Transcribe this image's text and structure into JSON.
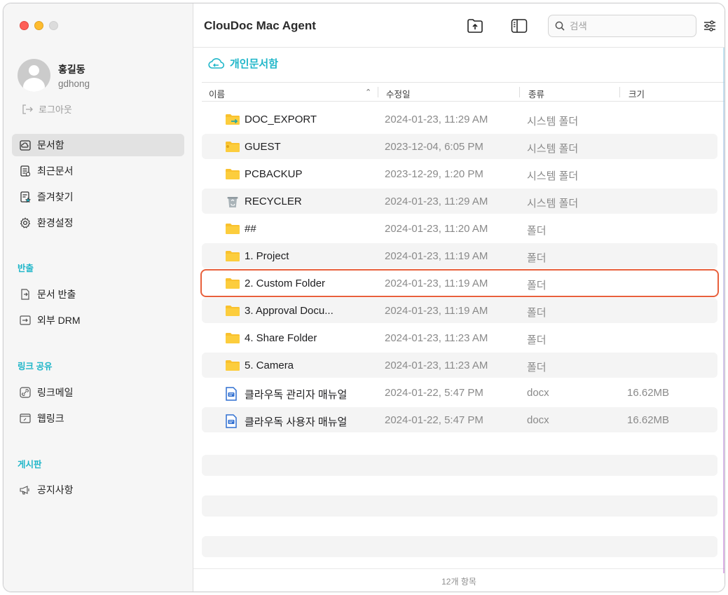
{
  "app": {
    "title": "ClouDoc Mac Agent"
  },
  "user": {
    "name": "홍길동",
    "id": "gdhong",
    "logout_label": "로그아웃"
  },
  "sidebar": {
    "items": [
      {
        "label": "문서함",
        "icon": "docbox-icon"
      },
      {
        "label": "최근문서",
        "icon": "recent-doc-icon"
      },
      {
        "label": "즐겨찾기",
        "icon": "favorite-icon"
      },
      {
        "label": "환경설정",
        "icon": "gear-icon"
      }
    ],
    "sections": [
      {
        "title": "반출",
        "items": [
          {
            "label": "문서 반출",
            "icon": "export-doc-icon"
          },
          {
            "label": "외부 DRM",
            "icon": "external-drm-icon"
          }
        ]
      },
      {
        "title": "링크 공유",
        "items": [
          {
            "label": "링크메일",
            "icon": "link-mail-icon"
          },
          {
            "label": "웹링크",
            "icon": "web-link-icon"
          }
        ]
      },
      {
        "title": "게시판",
        "items": [
          {
            "label": "공지사항",
            "icon": "megaphone-icon"
          }
        ]
      }
    ]
  },
  "search": {
    "placeholder": "검색"
  },
  "breadcrumb": {
    "label": "개인문서함"
  },
  "columns": {
    "name": "이름",
    "modified": "수정일",
    "kind": "종류",
    "size": "크기"
  },
  "files": [
    {
      "name": "DOC_EXPORT",
      "date": "2024-01-23, 11:29 AM",
      "kind": "시스템 폴더",
      "size": "",
      "icon": "export-folder-icon"
    },
    {
      "name": "GUEST",
      "date": "2023-12-04, 6:05 PM",
      "kind": "시스템 폴더",
      "size": "",
      "icon": "guest-folder-icon"
    },
    {
      "name": "PCBACKUP",
      "date": "2023-12-29, 1:20 PM",
      "kind": "시스템 폴더",
      "size": "",
      "icon": "folder-icon"
    },
    {
      "name": "RECYCLER",
      "date": "2024-01-23, 11:29 AM",
      "kind": "시스템 폴더",
      "size": "",
      "icon": "trash-icon"
    },
    {
      "name": "##",
      "date": "2024-01-23, 11:20 AM",
      "kind": "폴더",
      "size": "",
      "icon": "folder-icon"
    },
    {
      "name": "1. Project",
      "date": "2024-01-23, 11:19 AM",
      "kind": "폴더",
      "size": "",
      "icon": "folder-icon"
    },
    {
      "name": "2. Custom Folder",
      "date": "2024-01-23, 11:19 AM",
      "kind": "폴더",
      "size": "",
      "icon": "folder-icon"
    },
    {
      "name": "3. Approval Docu...",
      "date": "2024-01-23, 11:19 AM",
      "kind": "폴더",
      "size": "",
      "icon": "folder-icon"
    },
    {
      "name": "4. Share Folder",
      "date": "2024-01-23, 11:23 AM",
      "kind": "폴더",
      "size": "",
      "icon": "folder-icon"
    },
    {
      "name": "5. Camera",
      "date": "2024-01-23, 11:23 AM",
      "kind": "폴더",
      "size": "",
      "icon": "folder-icon"
    },
    {
      "name": "클라우독 관리자 매뉴얼",
      "date": "2024-01-22, 5:47 PM",
      "kind": "docx",
      "size": "16.62MB",
      "icon": "docx-file-icon"
    },
    {
      "name": "클라우독 사용자 매뉴얼",
      "date": "2024-01-22, 5:47 PM",
      "kind": "docx",
      "size": "16.62MB",
      "icon": "docx-file-icon"
    }
  ],
  "selected_index": 6,
  "footer": {
    "count_label": "12개 항목"
  },
  "colors": {
    "accent": "#1fb6c9",
    "selection": "#e8603c",
    "folder": "#f9c12e"
  }
}
